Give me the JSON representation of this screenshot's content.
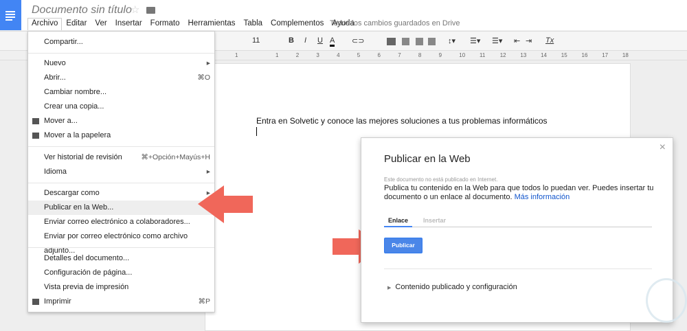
{
  "header": {
    "title": "Documento sin título",
    "saved_status": "Todos los cambios guardados en Drive"
  },
  "menubar": [
    "Archivo",
    "Editar",
    "Ver",
    "Insertar",
    "Formato",
    "Herramientas",
    "Tabla",
    "Complementos",
    "Ayuda"
  ],
  "toolbar": {
    "font_size": "11",
    "bold": "B",
    "italic": "I",
    "underline": "U",
    "text_color": "A",
    "clear_format": "Tx"
  },
  "ruler": [
    "1",
    "1",
    "2",
    "3",
    "4",
    "5",
    "6",
    "7",
    "8",
    "9",
    "10",
    "11",
    "12",
    "13",
    "14",
    "15",
    "16",
    "17",
    "18"
  ],
  "file_menu": [
    {
      "label": "Compartir...",
      "shortcut": ""
    },
    {
      "label": "Nuevo",
      "shortcut": "▸"
    },
    {
      "label": "Abrir...",
      "shortcut": "⌘O"
    },
    {
      "label": "Cambiar nombre...",
      "shortcut": ""
    },
    {
      "label": "Crear una copia...",
      "shortcut": ""
    },
    {
      "label": "Mover a...",
      "shortcut": "",
      "icon": "folder-icon"
    },
    {
      "label": "Mover a la papelera",
      "shortcut": "",
      "icon": "trash-icon"
    },
    {
      "label": "Ver historial de revisión",
      "shortcut": "⌘+Opción+Mayús+H"
    },
    {
      "label": "Idioma",
      "shortcut": "▸"
    },
    {
      "label": "Descargar como",
      "shortcut": "▸"
    },
    {
      "label": "Publicar en la Web...",
      "shortcut": "",
      "highlighted": true
    },
    {
      "label": "Enviar correo electrónico a colaboradores...",
      "shortcut": ""
    },
    {
      "label": "Enviar por correo electrónico como archivo adjunto...",
      "shortcut": ""
    },
    {
      "label": "Detalles del documento...",
      "shortcut": ""
    },
    {
      "label": "Configuración de página...",
      "shortcut": ""
    },
    {
      "label": "Vista previa de impresión",
      "shortcut": ""
    },
    {
      "label": "Imprimir",
      "shortcut": "⌘P",
      "icon": "print-icon"
    }
  ],
  "document": {
    "body_text": "Entra en Solvetic y conoce las mejores soluciones a tus problemas informáticos"
  },
  "dialog": {
    "title": "Publicar en la Web",
    "close": "×",
    "note": "Este documento no está publicado en Internet.",
    "description": "Publica tu contenido en la Web para que todos lo puedan ver. Puedes insertar tu documento o un enlace al documento.",
    "more_link": "Más información",
    "tabs": [
      "Enlace",
      "Insertar"
    ],
    "publish_button": "Publicar",
    "expander": "Contenido publicado y configuración"
  },
  "colors": {
    "accent": "#4285f4",
    "button": "#4a86e8",
    "arrow": "#f0675a"
  }
}
